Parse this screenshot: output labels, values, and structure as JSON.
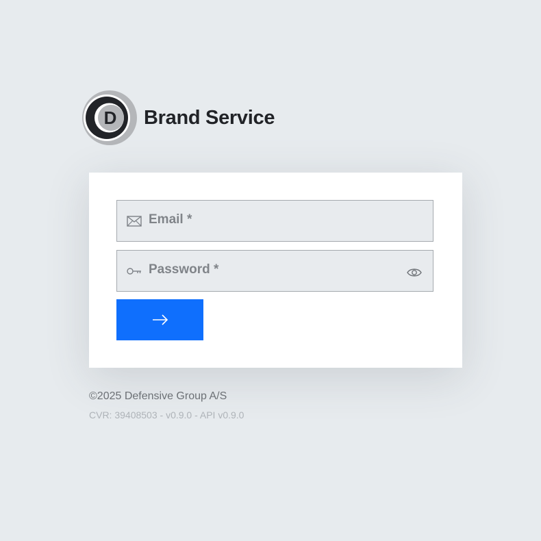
{
  "brand": {
    "logo_icon": "brand-d-logo-icon",
    "logo_letter": "D",
    "name": "Brand Service"
  },
  "login": {
    "email": {
      "icon": "envelope-icon",
      "placeholder": "Email *",
      "value": ""
    },
    "password": {
      "icon": "key-icon",
      "placeholder": "Password *",
      "value": "",
      "toggle_icon": "eye-icon"
    },
    "submit": {
      "icon": "arrow-right-icon"
    }
  },
  "footer": {
    "copyright": "©2025 Defensive Group A/S",
    "version_line": "CVR: 39408503 - v0.9.0 - API v0.9.0"
  },
  "colors": {
    "background": "#e7ebee",
    "card": "#ffffff",
    "field_bg": "#e8ebee",
    "field_border": "#a4a9ae",
    "accent": "#0f6ffd",
    "brand_text": "#212327"
  }
}
